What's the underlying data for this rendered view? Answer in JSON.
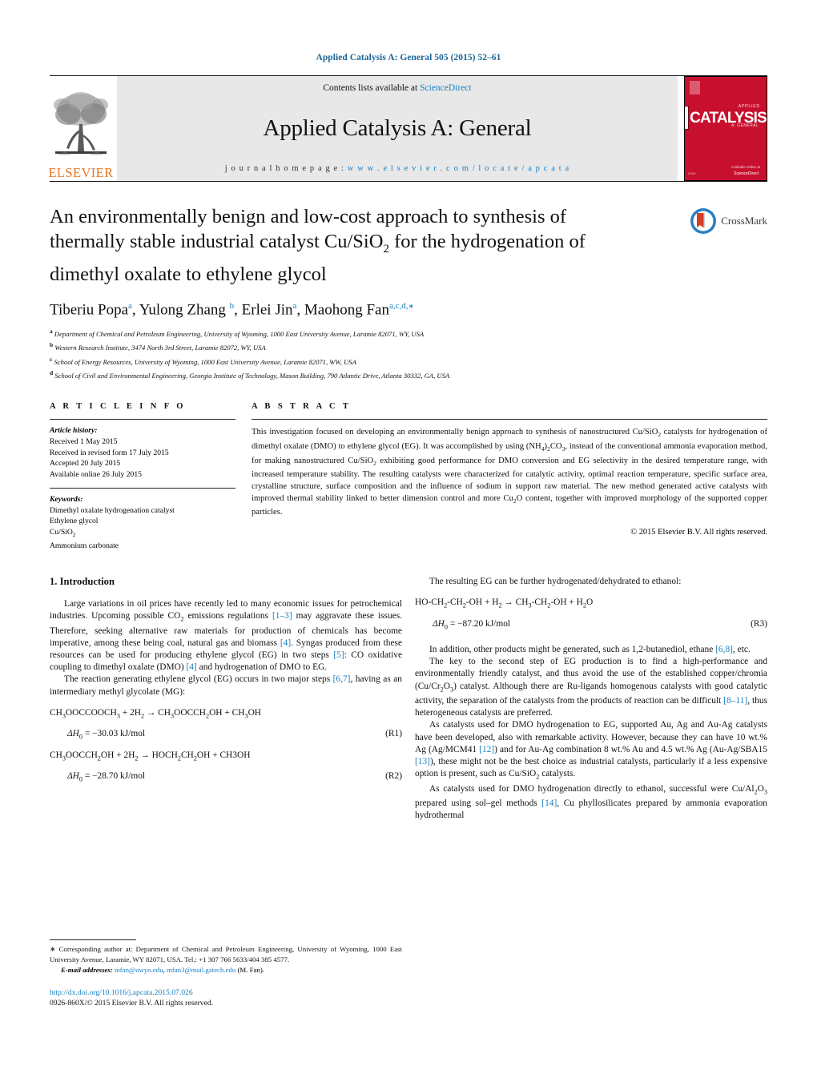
{
  "running_head": "Applied Catalysis A: General 505 (2015) 52–61",
  "masthead": {
    "publisher_name": "ELSEVIER",
    "contents_prefix": "Contents lists available at ",
    "contents_link": "ScienceDirect",
    "journal_title": "Applied Catalysis A: General",
    "homepage_prefix": "j o u r n a l   h o m e p a g e :  ",
    "homepage_url": "w w w . e l s e v i e r . c o m / l o c a t e / a p c a t a",
    "cover_word": "CATALYSIS",
    "cover_sup": "APPLIED",
    "cover_sub": "A: GENERAL",
    "cover_footer": "Available online at",
    "cover_sd": "ScienceDirect",
    "cover_band_color": "#c8102e",
    "accent_link_color": "#1a7fc1",
    "elsevier_orange": "#e87722"
  },
  "title": "An environmentally benign and low-cost approach to synthesis of thermally stable industrial catalyst Cu/SiO₂ for the hydrogenation of dimethyl oxalate to ethylene glycol",
  "crossmark": {
    "label": "CrossMark"
  },
  "authors_plain": "Tiberiu Popa a, Yulong Zhang b, Erlei Jin a, Maohong Fan a,c,d,*",
  "authors": [
    {
      "name": "Tiberiu Popa",
      "marks": "a"
    },
    {
      "name": "Yulong Zhang",
      "marks": "b"
    },
    {
      "name": "Erlei Jin",
      "marks": "a"
    },
    {
      "name": "Maohong Fan",
      "marks": "a,c,d,*"
    }
  ],
  "affiliations": [
    {
      "mark": "a",
      "text": "Department of Chemical and Petroleum Engineering, University of Wyoming, 1000 East University Avenue, Laramie 82071, WY, USA"
    },
    {
      "mark": "b",
      "text": "Western Research Institute, 3474 North 3rd Street, Laramie 82072, WY, USA"
    },
    {
      "mark": "c",
      "text": "School of Energy Resources, University of Wyoming, 1000 East University Avenue, Laramie 82071, WW, USA"
    },
    {
      "mark": "d",
      "text": "School of Civil and Environmental Engineering, Georgia Institute of Technology, Mason Building, 790 Atlantic Drive, Atlanta 30332, GA, USA"
    }
  ],
  "article_info": {
    "heading": "A R T I C L E   I N F O",
    "history_label": "Article history:",
    "history": [
      "Received 1 May 2015",
      "Received in revised form 17 July 2015",
      "Accepted 20 July 2015",
      "Available online 26 July 2015"
    ],
    "keywords_label": "Keywords:",
    "keywords": [
      "Dimethyl oxalate hydrogenation catalyst",
      "Ethylene glycol",
      "Cu/SiO2",
      "Ammonium carbonate"
    ]
  },
  "abstract": {
    "heading": "A B S T R A C T",
    "text": "This investigation focused on developing an environmentally benign approach to synthesis of nanostructured Cu/SiO2 catalysts for hydrogenation of dimethyl oxalate (DMO) to ethylene glycol (EG). It was accomplished by using (NH4)2CO3, instead of the conventional ammonia evaporation method, for making nanostructured Cu/SiO2 exhibiting good performance for DMO conversion and EG selectivity in the desired temperature range, with increased temperature stability. The resulting catalysts were characterized for catalytic activity, optimal reaction temperature, specific surface area, crystalline structure, surface composition and the influence of sodium in support raw material. The new method generated active catalysts with improved thermal stability linked to better dimension control and more Cu2O content, together with improved morphology of the supported copper particles.",
    "copyright": "© 2015 Elsevier B.V. All rights reserved."
  },
  "body": {
    "section1_title": "1.  Introduction",
    "left_paragraph_1": "Large variations in oil prices have recently led to many economic issues for petrochemical industries. Upcoming possible CO2 emissions regulations [1–3] may aggravate these issues. Therefore, seeking alternative raw materials for production of chemicals has become imperative, among these being coal, natural gas and biomass [4]. Syngas produced from these resources can be used for producing ethylene glycol (EG) in two steps [5]: CO oxidative coupling to dimethyl oxalate (DMO) [4] and hydrogenation of DMO to EG.",
    "left_paragraph_2": "The reaction generating ethylene glycol (EG) occurs in two major steps [6,7], having as an intermediary methyl glycolate (MG):",
    "eq_r1_reaction": "CH3OOCCOOCH3 + 2H2 →  CH3OOCCH2OH + CH3OH",
    "eq_r1_enthalpy": "ΔH0 =  −30.03 kJ/mol",
    "eq_r1_number": "(R1)",
    "eq_r2_reaction": "CH3OOCCH2OH + 2H2 →  HOCH2CH2OH + CH3OH",
    "eq_r2_enthalpy": "ΔH0 =  −28.70 kJ/mol",
    "eq_r2_number": "(R2)",
    "right_paragraph_1": "The resulting EG can be further hydrogenated/dehydrated to ethanol:",
    "eq_r3_reaction": "HO-CH2-CH2-OH + H2 →  CH3-CH2-OH + H2O",
    "eq_r3_enthalpy": "ΔH0 =  −87.20 kJ/mol",
    "eq_r3_number": "(R3)",
    "right_paragraph_2": "In addition, other products might be generated, such as 1,2-butanediol, ethane [6,8], etc.",
    "right_paragraph_3": "The key to the second step of EG production is to find a high-performance and environmentally friendly catalyst, and thus avoid the use of the established copper/chromia (Cu/Cr2O3) catalyst. Although there are Ru-ligands homogenous catalysts with good catalytic activity, the separation of the catalysts from the products of reaction can be difficult [8–11], thus heterogeneous catalysts are preferred.",
    "right_paragraph_4": "As catalysts used for DMO hydrogenation to EG, supported Au, Ag and Au-Ag catalysts have been developed, also with remarkable activity. However, because they can have 10 wt.% Ag (Ag/MCM41 [12]) and for Au-Ag combination 8 wt.% Au and 4.5 wt.% Ag (Au-Ag/SBA15 [13]), these might not be the best choice as industrial catalysts, particularly if a less expensive option is present, such as Cu/SiO2 catalysts.",
    "right_paragraph_5": "As catalysts used for DMO hydrogenation directly to ethanol, successful were Cu/Al2O3 prepared using sol–gel methods [14], Cu phyllosilicates prepared by ammonia evaporation hydrothermal"
  },
  "footnote": {
    "star": "*",
    "corresponding": "Corresponding author at: Department of Chemical and Petroleum Engineering, University of Wyoming, 1000 East University Avenue, Laramie, WY 82071, USA. Tel.: +1 307 766 5633/404 385 4577.",
    "email_label": "E-mail addresses:",
    "email_1": "mfan@uwyo.edu",
    "email_2": "mfan3@mail.gatech.edu",
    "email_suffix": "(M. Fan)."
  },
  "footer": {
    "doi": "http://dx.doi.org/10.1016/j.apcata.2015.07.026",
    "issn": "0926-860X/© 2015 Elsevier B.V. All rights reserved."
  }
}
